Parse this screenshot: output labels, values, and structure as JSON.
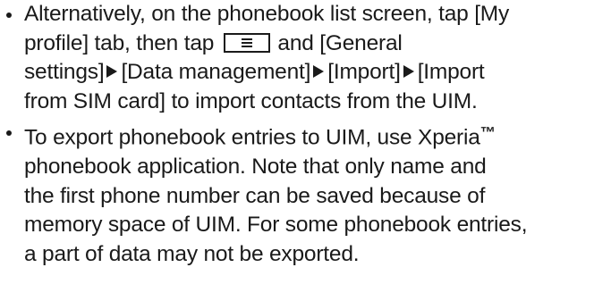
{
  "notes": [
    {
      "lines": [
        "Alternatively, on the phonebook list screen, tap [My",
        "profile] tab, then tap",
        "and [General",
        "settings]",
        "[Data management]",
        "[Import]",
        "[Import",
        "from SIM card] to import contacts from the UIM."
      ],
      "icons": [
        "menu-key-icon",
        "right-triangle-arrow-icon"
      ]
    },
    {
      "lines": [
        "To export phonebook entries to UIM, use Xperia",
        "™",
        "phonebook application. Note that only name and",
        "the first phone number can be saved because of",
        "memory space of UIM. For some phonebook entries,",
        "a part of data may not be exported."
      ]
    }
  ]
}
